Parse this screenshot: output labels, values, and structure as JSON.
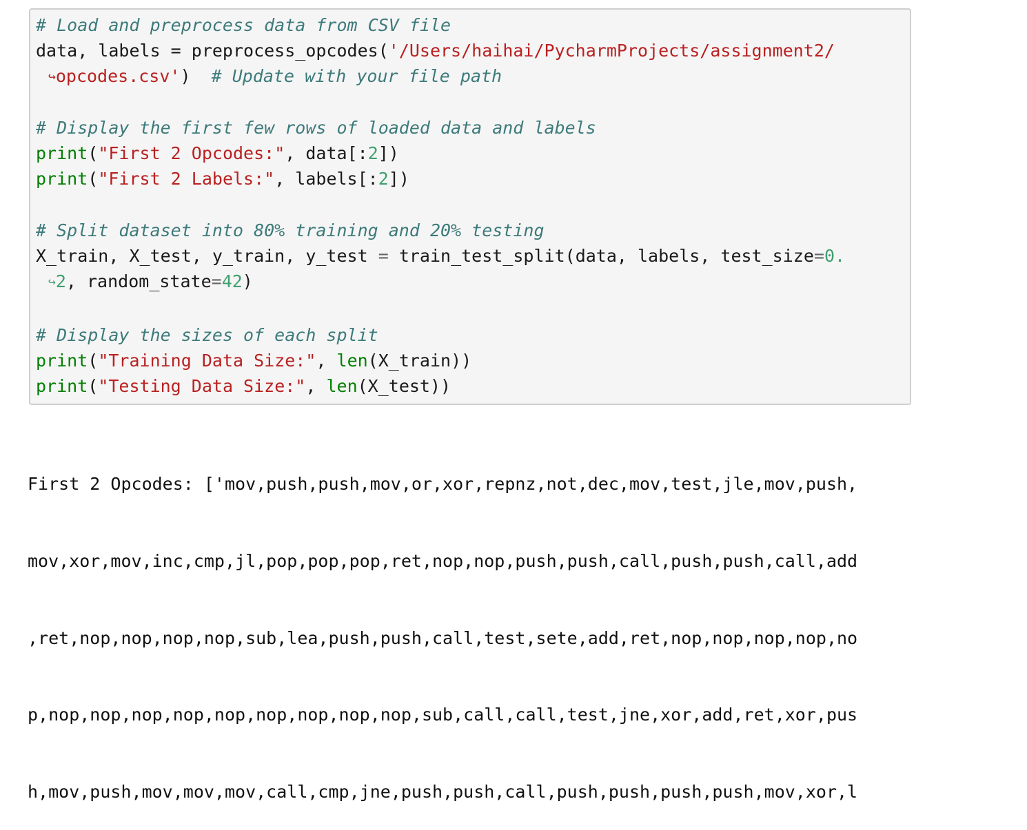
{
  "code": {
    "comment1": "# Load and preprocess data from CSV file",
    "line2_a": "data, labels = preprocess_opcodes(",
    "line2_str": "'/Users/haihai/PycharmProjects/assignment2/",
    "line2_cont_str": "opcodes.csv'",
    "line2_cont_close": ")  ",
    "line2_cont_comment": "# Update with your file path",
    "comment2": "# Display the first few rows of loaded data and labels",
    "print1_fn": "print",
    "print1_open": "(",
    "print1_str": "\"First 2 Opcodes:\"",
    "print1_rest_a": ", data[:",
    "print1_num": "2",
    "print1_rest_b": "])",
    "print2_fn": "print",
    "print2_open": "(",
    "print2_str": "\"First 2 Labels:\"",
    "print2_rest_a": ", labels[:",
    "print2_num": "2",
    "print2_rest_b": "])",
    "comment3": "# Split dataset into 80% training and 20% testing",
    "split_a": "X_train, X_test, y_train, y_test ",
    "split_eq": "=",
    "split_b": " train_test_split(data, labels, test_size",
    "split_eq2": "=",
    "split_num1": "0.",
    "split_cont_num": "2",
    "split_cont_a": ", random_state",
    "split_cont_eq": "=",
    "split_cont_num2": "42",
    "split_cont_close": ")",
    "comment4": "# Display the sizes of each split",
    "print3_fn": "print",
    "print3_open": "(",
    "print3_str": "\"Training Data Size:\"",
    "print3_mid": ", ",
    "print3_len": "len",
    "print3_rest": "(X_train))",
    "print4_fn": "print",
    "print4_open": "(",
    "print4_str": "\"Testing Data Size:\"",
    "print4_mid": ", ",
    "print4_len": "len",
    "print4_rest": "(X_test))",
    "wrap_arrow": "↪"
  },
  "output": {
    "lines": [
      "First 2 Opcodes: ['mov,push,push,mov,or,xor,repnz,not,dec,mov,test,jle,mov,push,",
      "mov,xor,mov,inc,cmp,jl,pop,pop,pop,ret,nop,nop,push,push,call,push,push,call,add",
      ",ret,nop,nop,nop,nop,sub,lea,push,push,call,test,sete,add,ret,nop,nop,nop,nop,no",
      "p,nop,nop,nop,nop,nop,nop,nop,nop,nop,sub,call,call,test,jne,xor,add,ret,xor,pus",
      "h,mov,push,mov,mov,mov,call,cmp,jne,push,push,call,push,push,push,push,mov,xor,l"
    ]
  },
  "colors": {
    "comment": "#3d7a7a",
    "string": "#ba2121",
    "builtin": "#008000",
    "number": "#40a070",
    "cell_background": "#f5f5f5",
    "cell_border": "#cfcfcf"
  }
}
